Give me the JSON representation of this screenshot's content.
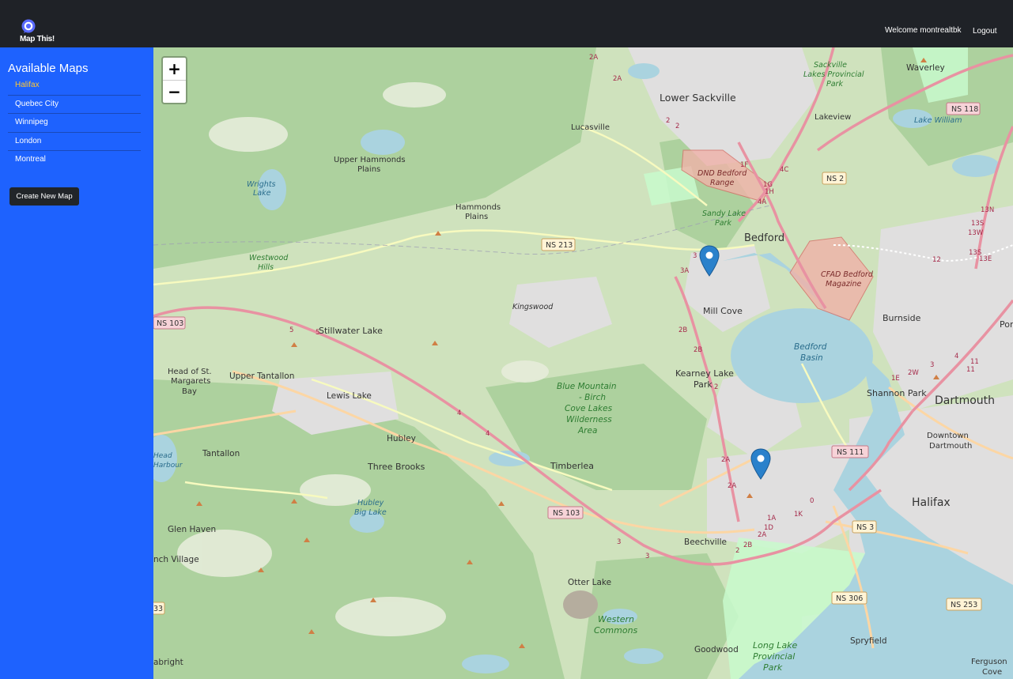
{
  "header": {
    "app_name": "Map This!",
    "welcome_text": "Welcome montrealtbk",
    "logout_label": "Logout"
  },
  "sidebar": {
    "title": "Available Maps",
    "maps": [
      {
        "label": "Halifax",
        "active": true
      },
      {
        "label": "Quebec City",
        "active": false
      },
      {
        "label": "Winnipeg",
        "active": false
      },
      {
        "label": "London",
        "active": false
      },
      {
        "label": "Montreal",
        "active": false
      }
    ],
    "create_button_label": "Create New Map"
  },
  "map": {
    "zoom_in_label": "+",
    "zoom_out_label": "−",
    "markers": 2,
    "place_labels": {
      "lower_sackville": "Lower Sackville",
      "lucasville": "Lucasville",
      "sackville_lakes_1": "Sackville",
      "sackville_lakes_2": "Lakes Provincial",
      "sackville_lakes_3": "Park",
      "waverley": "Waverley",
      "lakeview": "Lakeview",
      "lake_william": "Lake William",
      "upper_hammonds_1": "Upper Hammonds",
      "upper_hammonds_2": "Plains",
      "wrights_1": "Wrights",
      "wrights_2": "Lake",
      "hammonds_1": "Hammonds",
      "hammonds_2": "Plains",
      "dnd_1": "DND Bedford",
      "dnd_2": "Range",
      "sandy_1": "Sandy Lake",
      "sandy_2": "Park",
      "bedford": "Bedford",
      "cfad_1": "CFAD Bedford",
      "cfad_2": "Magazine",
      "westwood_1": "Westwood",
      "westwood_2": "Hills",
      "kingswood": "Kingswood",
      "mill_cove": "Mill Cove",
      "burnside": "Burnside",
      "port": "Port",
      "stillwater": "Stillwater Lake",
      "bedford_basin_1": "Bedford",
      "bedford_basin_2": "Basin",
      "head_st_1": "Head of St.",
      "head_st_2": "Margarets",
      "head_st_3": "Bay",
      "upper_tantallon": "Upper Tantallon",
      "kearney_1": "Kearney Lake",
      "kearney_2": "Park",
      "shannon_park": "Shannon Park",
      "dartmouth": "Dartmouth",
      "lewis_lake": "Lewis Lake",
      "blue_mountain_1": "Blue Mountain",
      "blue_mountain_2": "- Birch",
      "blue_mountain_3": "Cove Lakes",
      "blue_mountain_4": "Wilderness",
      "blue_mountain_5": "Area",
      "hubley": "Hubley",
      "downtown_1": "Downtown",
      "downtown_2": "Dartmouth",
      "tantallon": "Tantallon",
      "head_harbour_1": "Head",
      "head_harbour_2": "Harbour",
      "three_brooks": "Three Brooks",
      "timberlea": "Timberlea",
      "halifax": "Halifax",
      "hubley_big_1": "Hubley",
      "hubley_big_2": "Big Lake",
      "glen_haven": "Glen Haven",
      "beechville": "Beechville",
      "nch_village": "nch Village",
      "otter_lake": "Otter Lake",
      "spryfield": "Spryfield",
      "western_1": "Western",
      "western_2": "Commons",
      "goodwood": "Goodwood",
      "long_lake_1": "Long Lake",
      "long_lake_2": "Provincial",
      "long_lake_3": "Park",
      "fergusons_1": "Ferguson",
      "fergusons_2": "Cove",
      "abright": "abright"
    },
    "road_shields": {
      "ns118": "NS 118",
      "ns2": "NS 2",
      "ns213": "NS 213",
      "ns103_a": "NS 103",
      "ns111": "NS 111",
      "ns103_b": "NS 103",
      "ns3": "NS 3",
      "ns306": "NS 306",
      "ns253": "NS 253",
      "n33": "33"
    },
    "exit_labels": [
      "2A",
      "2A",
      "2",
      "2",
      "1F",
      "1G",
      "1H",
      "4A",
      "4C",
      "3",
      "3A",
      "2B",
      "2B",
      "2",
      "5",
      "5",
      "4",
      "4",
      "2A",
      "2A",
      "1A",
      "1D",
      "2A",
      "2B",
      "2",
      "3",
      "3",
      "0",
      "1K",
      "1E",
      "2W",
      "3",
      "4",
      "11",
      "11",
      "12",
      "13S",
      "13E",
      "13N",
      "13W",
      "13S"
    ],
    "colors": {
      "land": "#cfe2bd",
      "forest": "#add19e",
      "urban": "#e0dfdf",
      "water": "#aad3df",
      "motorway": "#e892a2",
      "primary": "#fcd6a4",
      "military": "#f0b2a9",
      "park_text": "#2e7d32"
    }
  }
}
